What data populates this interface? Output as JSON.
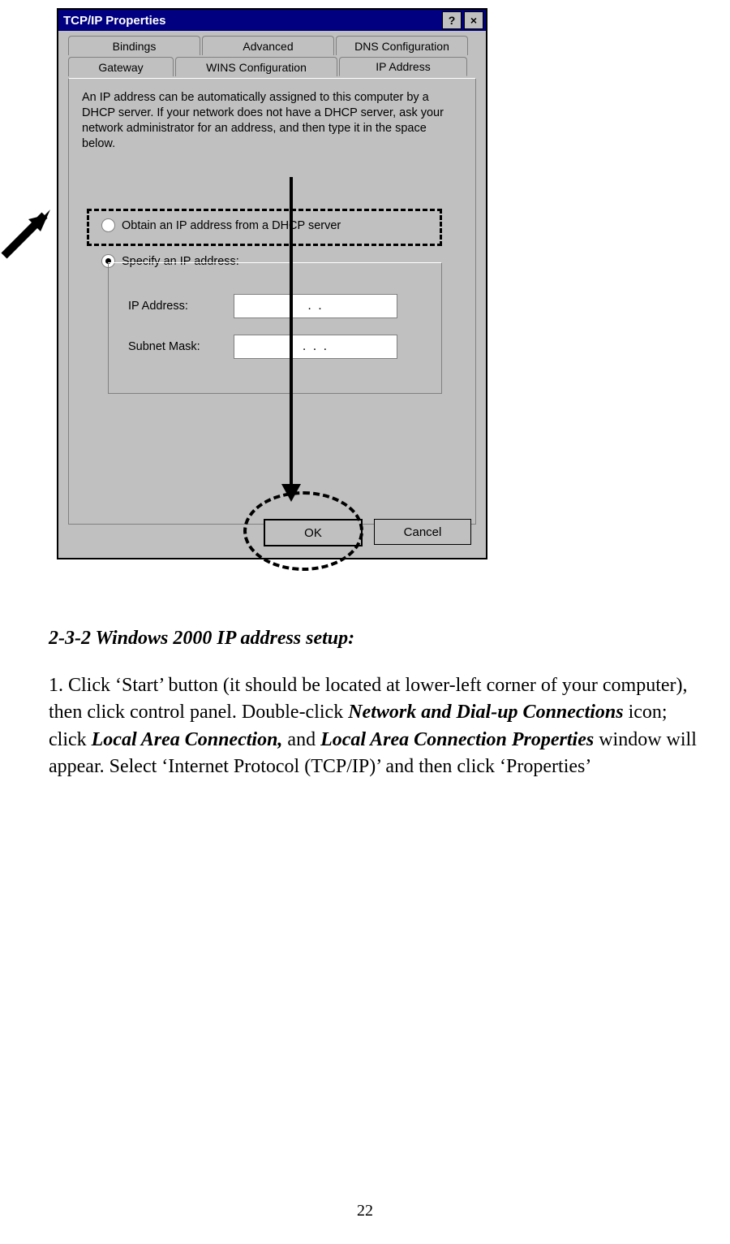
{
  "dialog": {
    "title": "TCP/IP Properties",
    "help_btn": "?",
    "close_btn": "×",
    "tabs_row1": [
      "Bindings",
      "Advanced",
      "DNS Configuration"
    ],
    "tabs_row2": [
      "Gateway",
      "WINS Configuration",
      "IP Address"
    ],
    "description": "An IP address can be automatically assigned to this computer by a DHCP server. If your network does not have a DHCP server, ask your network administrator for an address, and then type it in the space below.",
    "radio_dhcp": "Obtain an IP address from a DHCP server",
    "radio_specify": "Specify an IP address:",
    "ip_label": "IP Address:",
    "subnet_label": "Subnet Mask:",
    "ip_value": ".       .",
    "subnet_value": ".       .       .",
    "ok": "OK",
    "cancel": "Cancel"
  },
  "doc": {
    "heading": "2-3-2 Windows 2000 IP address setup:",
    "p_a": "1. Click ‘Start’ button (it should be located at lower-left corner of your computer), then click control panel. Double-click ",
    "p_b": "Network and Dial-up Connections",
    "p_c": " icon; click ",
    "p_d": "Local Area Connection,",
    "p_e": " and ",
    "p_f": "Local Area Connection Properties",
    "p_g": " window will appear. Select ‘Internet Protocol (TCP/IP)’ and then click ‘Properties’",
    "page_number": "22"
  }
}
